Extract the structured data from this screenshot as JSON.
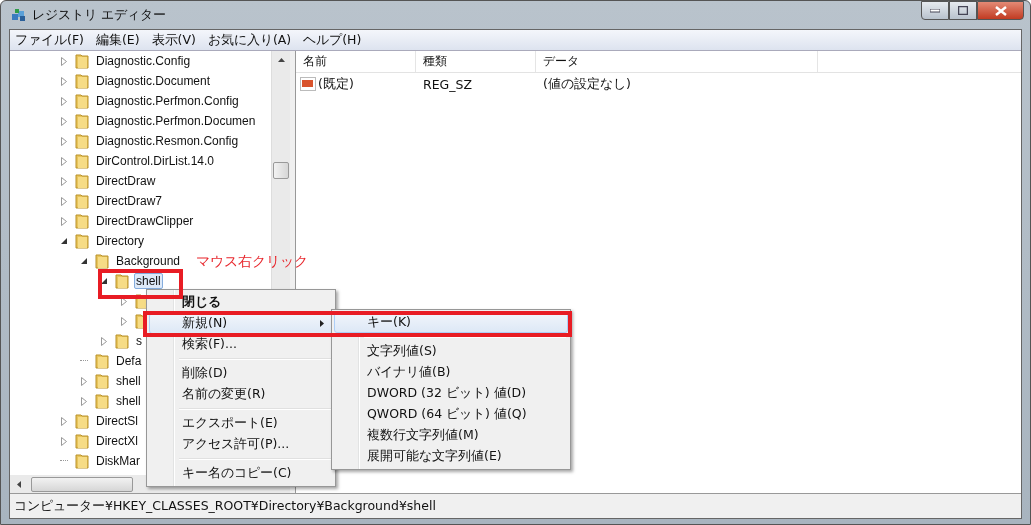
{
  "window": {
    "title": "レジストリ エディター"
  },
  "menu_bar": [
    "ファイル(F)",
    "編集(E)",
    "表示(V)",
    "お気に入り(A)",
    "ヘルプ(H)"
  ],
  "tree": [
    {
      "label": "Diagnostic.Config",
      "expanded": false,
      "selected": false
    },
    {
      "label": "Diagnostic.Document",
      "expanded": false,
      "selected": false
    },
    {
      "label": "Diagnostic.Perfmon.Config",
      "expanded": false,
      "selected": false
    },
    {
      "label": "Diagnostic.Perfmon.Documen",
      "expanded": false,
      "selected": false
    },
    {
      "label": "Diagnostic.Resmon.Config",
      "expanded": false,
      "selected": false
    },
    {
      "label": "DirControl.DirList.14.0",
      "expanded": false,
      "selected": false
    },
    {
      "label": "DirectDraw",
      "expanded": false,
      "selected": false
    },
    {
      "label": "DirectDraw7",
      "expanded": false,
      "selected": false
    },
    {
      "label": "DirectDrawClipper",
      "expanded": false,
      "selected": false
    },
    {
      "label": "Directory",
      "expanded": true,
      "selected": false,
      "children": [
        {
          "label": "Background",
          "expanded": true,
          "selected": false,
          "children": [
            {
              "label": "shell",
              "expanded": true,
              "selected": true,
              "children": [
                {
                  "expanded": false
                },
                {
                  "expanded": false
                }
              ]
            },
            {
              "label": "s",
              "expanded": false,
              "selected": false
            }
          ]
        },
        {
          "label": "Defa",
          "selected": false
        },
        {
          "label": "shell",
          "expanded": false,
          "selected": false
        },
        {
          "label": "shell",
          "expanded": false,
          "selected": false
        }
      ]
    },
    {
      "label": "DirectSl",
      "expanded": false,
      "selected": false
    },
    {
      "label": "DirectXl",
      "expanded": false,
      "selected": false
    },
    {
      "label": "DiskMar",
      "selected": false
    }
  ],
  "values": {
    "columns": [
      "名前",
      "種類",
      "データ"
    ],
    "rows": [
      {
        "name": "(既定)",
        "type": "REG_SZ",
        "data": "(値の設定なし)"
      }
    ]
  },
  "context_menu": {
    "items": [
      {
        "kind": "item",
        "label": "閉じる",
        "bold": true,
        "selected": false
      },
      {
        "kind": "item",
        "label": "新規(N)",
        "submenu": true,
        "selected": true
      },
      {
        "kind": "item",
        "label": "検索(F)...",
        "selected": false
      },
      {
        "kind": "separator"
      },
      {
        "kind": "item",
        "label": "削除(D)",
        "selected": false
      },
      {
        "kind": "item",
        "label": "名前の変更(R)",
        "selected": false
      },
      {
        "kind": "separator"
      },
      {
        "kind": "item",
        "label": "エクスポート(E)",
        "selected": false
      },
      {
        "kind": "item",
        "label": "アクセス許可(P)...",
        "selected": false
      },
      {
        "kind": "separator"
      },
      {
        "kind": "item",
        "label": "キー名のコピー(C)",
        "selected": false
      }
    ]
  },
  "submenu": {
    "items": [
      {
        "kind": "item",
        "label": "キー(K)",
        "selected": true
      },
      {
        "kind": "separator"
      },
      {
        "kind": "item",
        "label": "文字列値(S)",
        "selected": false
      },
      {
        "kind": "item",
        "label": "バイナリ値(B)",
        "selected": false
      },
      {
        "kind": "item",
        "label": "DWORD (32 ビット) 値(D)",
        "selected": false
      },
      {
        "kind": "item",
        "label": "QWORD (64 ビット) 値(Q)",
        "selected": false
      },
      {
        "kind": "item",
        "label": "複数行文字列値(M)",
        "selected": false
      },
      {
        "kind": "item",
        "label": "展開可能な文字列値(E)",
        "selected": false
      }
    ]
  },
  "annotation": "マウス右クリック",
  "status_bar": "コンピューター¥HKEY_CLASSES_ROOT¥Directory¥Background¥shell"
}
